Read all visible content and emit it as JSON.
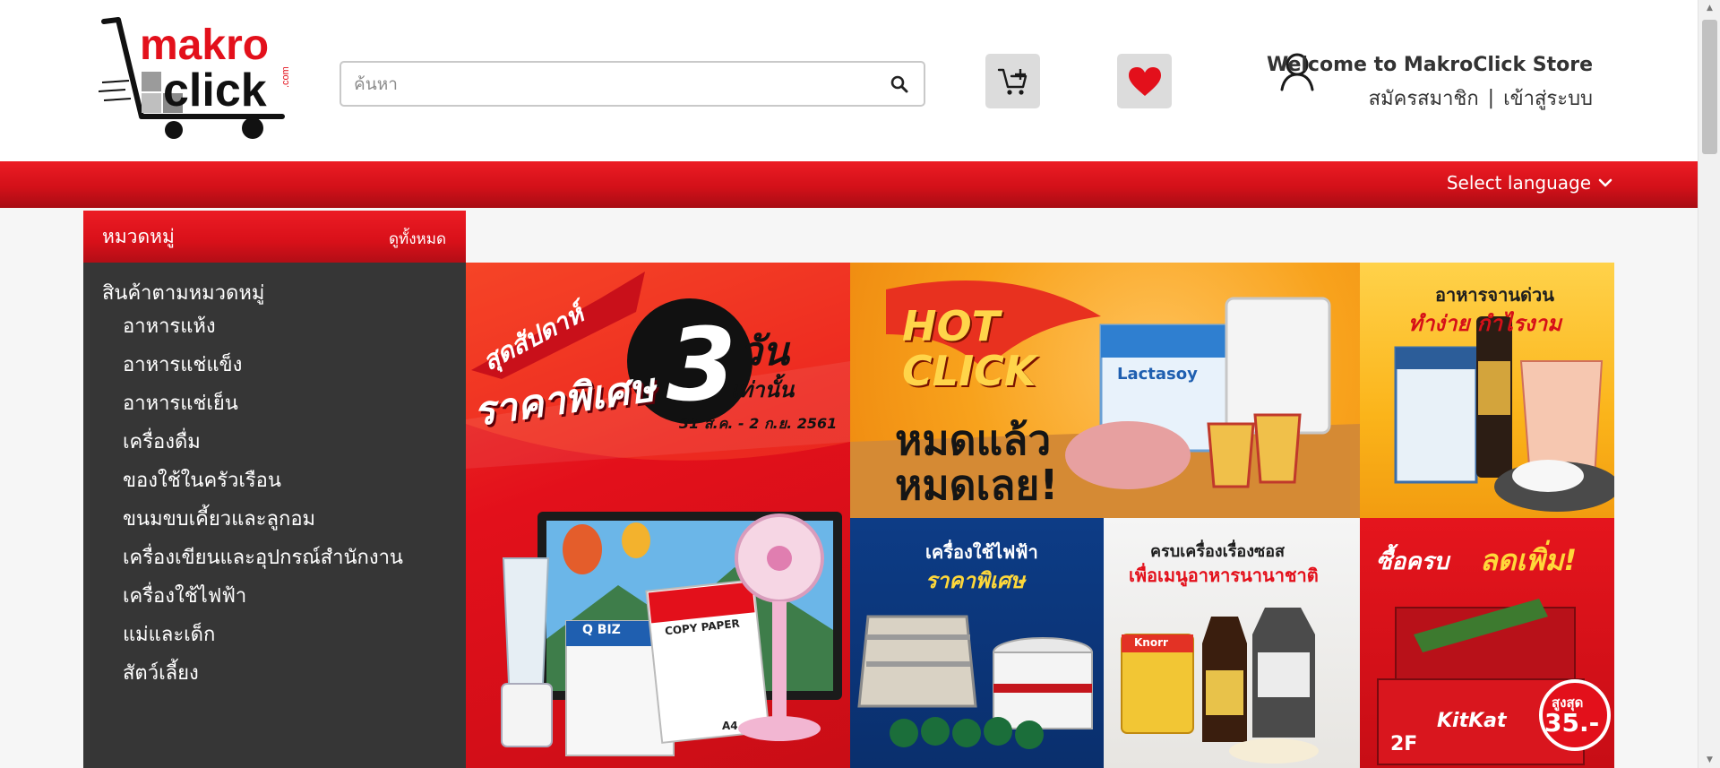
{
  "header": {
    "logo": {
      "line1": "makro",
      "line2": "click",
      "suffix": ".com"
    },
    "search": {
      "placeholder": "ค้นหา",
      "icon": "search-icon"
    },
    "cart_icon": "cart-add-icon",
    "wishlist_icon": "heart-icon",
    "user_icon": "user-icon",
    "welcome": "Welcome to MakroClick Store",
    "register": "สมัครสมาชิก",
    "separator": "|",
    "login": "เข้าสู่ระบบ"
  },
  "nav": {
    "language": "Select language",
    "language_icon": "chevron-down-icon"
  },
  "categories": {
    "title": "หมวดหมู่",
    "view_all": "ดูทั้งหมด",
    "group": "สินค้าตามหมวดหมู่",
    "items": [
      "อาหารแห้ง",
      "อาหารแช่แข็ง",
      "อาหารแช่เย็น",
      "เครื่องดื่ม",
      "ของใช้ในครัวเรือน",
      "ขนมขบเคี้ยวและลูกอม",
      "เครื่องเขียนและอุปกรณ์สำนักงาน",
      "เครื่องใช้ไฟฟ้า",
      "แม่และเด็ก",
      "สัตว์เลี้ยง"
    ]
  },
  "banners": {
    "weekend": {
      "ribbon": "สุดสัปดาห์",
      "headline": "ราคาพิเศษ",
      "number": "3",
      "unit": "วัน",
      "suffix": "เท่านั้น",
      "dates": "31 ส.ค. - 2 ก.ย. 2561",
      "paper_brand": "Q BIZ",
      "paper_label": "COPY PAPER",
      "paper_size": "A4"
    },
    "hot_click": {
      "brand_line1": "HOT",
      "brand_line2": "CLICK",
      "line1": "หมดแล้ว",
      "line2": "หมดเลย!",
      "product_label": "Lactasoy"
    },
    "quick_food": {
      "line1": "อาหารจานด่วน",
      "line2": "ทำง่าย กำไรงาม"
    },
    "appliances": {
      "line1": "เครื่องใช้ไฟฟ้า",
      "line2": "ราคาพิเศษ"
    },
    "sauces": {
      "line1": "ครบเครื่องเรื่องซอส",
      "line2": "เพื่อเมนูอาหารนานาชาติ",
      "product_label": "Knorr"
    },
    "discount": {
      "line1": "ซื้อครบ",
      "line2": "ลดเพิ่ม!",
      "max_label": "สูงสุด",
      "max_value": "35.-",
      "box_label": "2F",
      "brand": "KitKat"
    }
  },
  "colors": {
    "brand_red": "#e3101b",
    "sidebar_bg": "#363636",
    "text_dark": "#333333"
  }
}
